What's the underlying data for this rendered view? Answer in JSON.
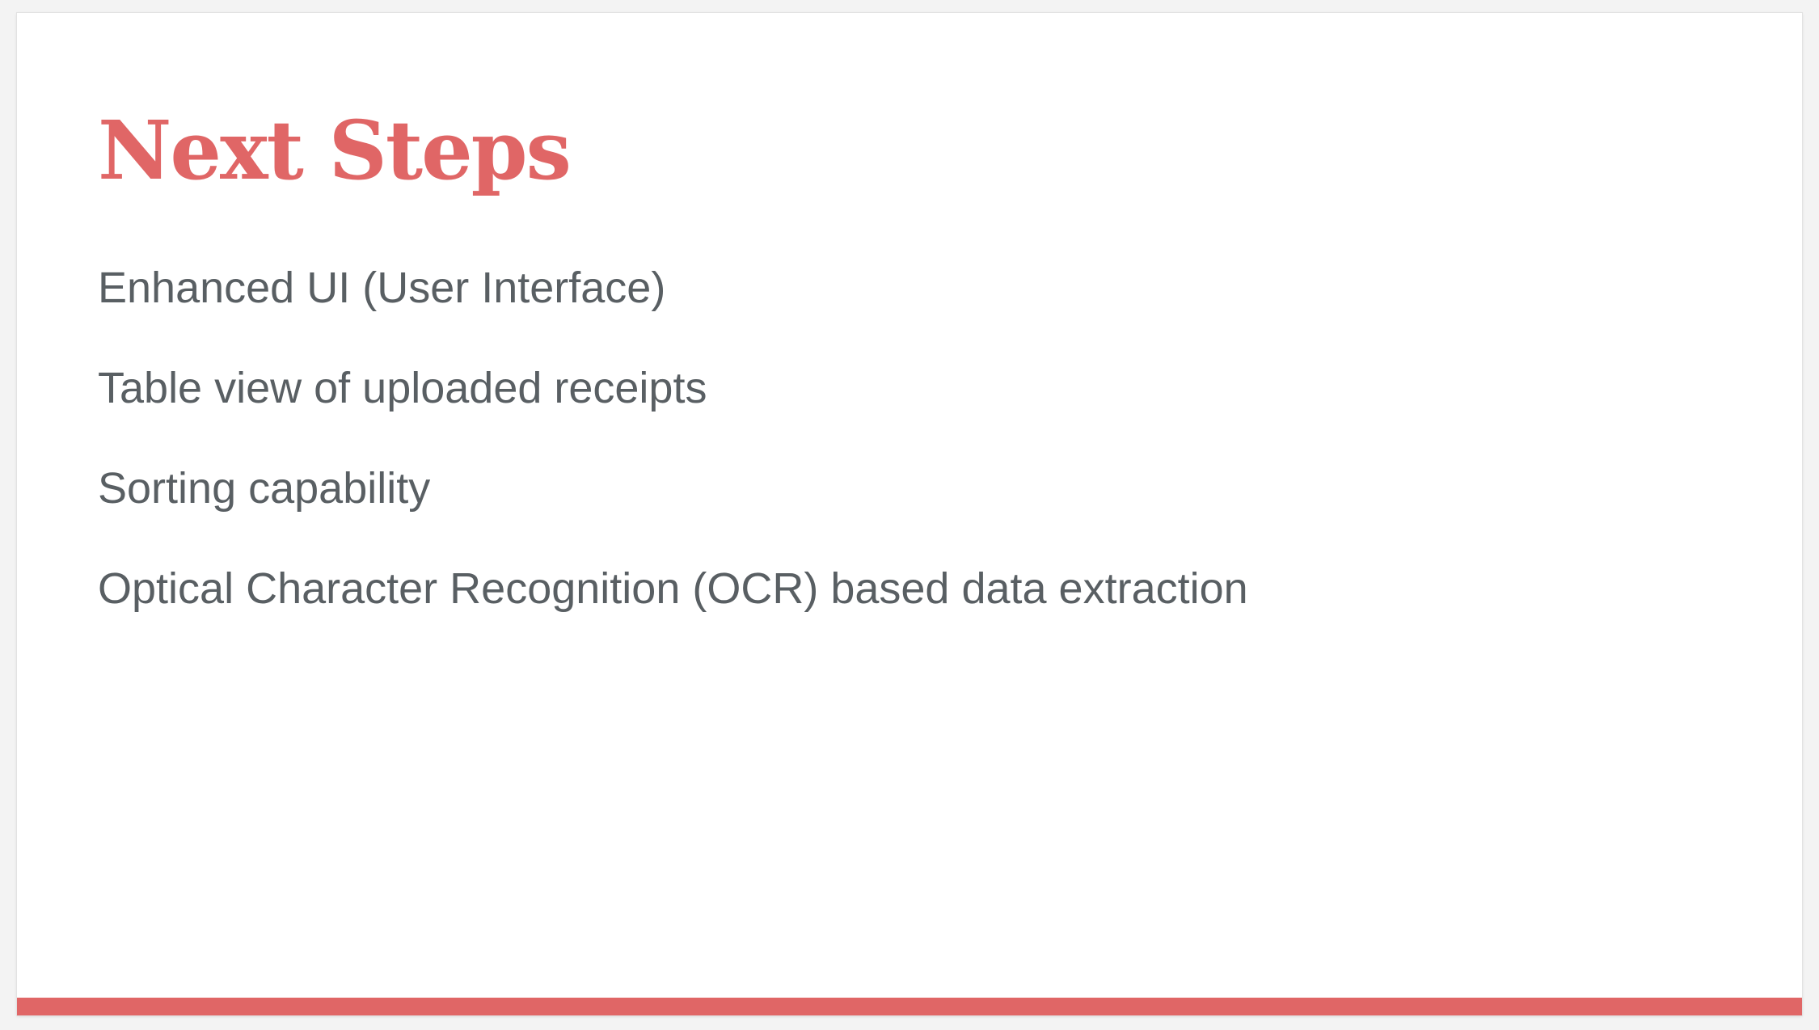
{
  "slide": {
    "title": "Next Steps",
    "items": [
      {
        "text": "Enhanced UI (User Interface)"
      },
      {
        "text": "Table view of uploaded receipts"
      },
      {
        "text": "Sorting capability"
      },
      {
        "text": "Optical Character Recognition (OCR) based data extraction"
      }
    ]
  },
  "colors": {
    "accent": "#e06666",
    "body_text": "#595f63",
    "background": "#ffffff"
  }
}
